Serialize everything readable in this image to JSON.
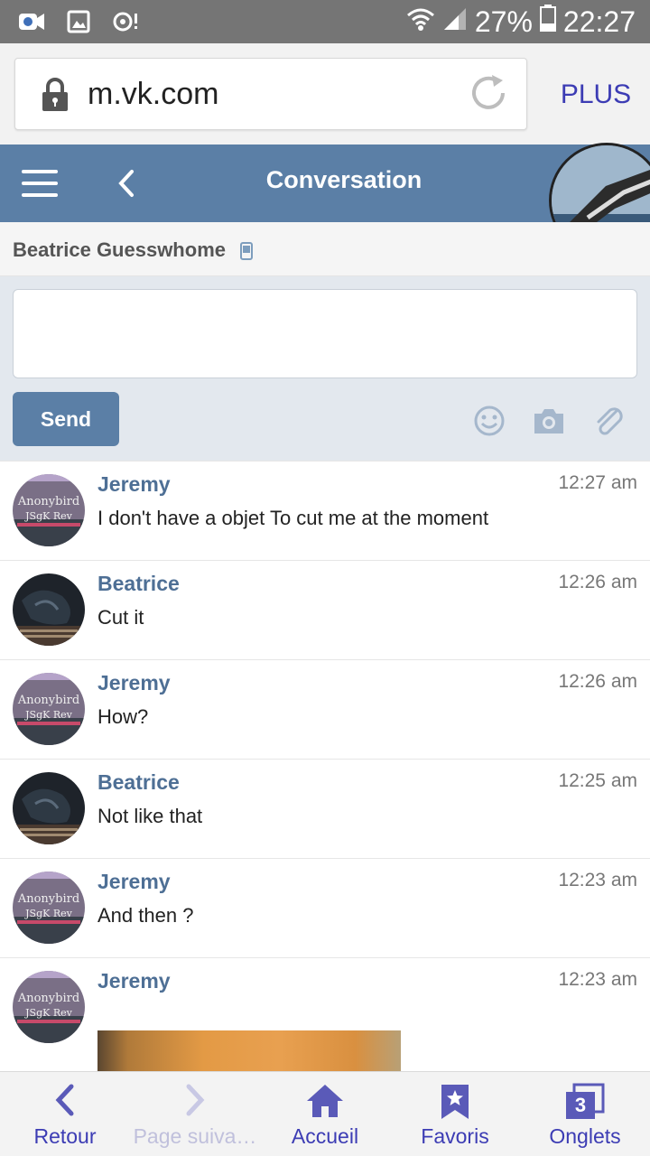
{
  "statusbar": {
    "battery": "27%",
    "time": "22:27"
  },
  "browser": {
    "url": "m.vk.com",
    "menu_label": "PLUS"
  },
  "header": {
    "title": "Conversation"
  },
  "peer": {
    "name": "Beatrice Guesswhome"
  },
  "compose": {
    "placeholder": "",
    "send_label": "Send"
  },
  "messages": [
    {
      "author": "Jeremy",
      "time": "12:27 am",
      "text": "I don't have a objet To cut me at the moment"
    },
    {
      "author": "Beatrice",
      "time": "12:26 am",
      "text": "Cut it"
    },
    {
      "author": "Jeremy",
      "time": "12:26 am",
      "text": "How?"
    },
    {
      "author": "Beatrice",
      "time": "12:25 am",
      "text": "Not like that"
    },
    {
      "author": "Jeremy",
      "time": "12:23 am",
      "text": "And then ?"
    },
    {
      "author": "Jeremy",
      "time": "12:23 am",
      "text": ""
    }
  ],
  "avatars": {
    "jeremy_line1": "Anonybird",
    "jeremy_line2": "JSgK Rev"
  },
  "bottomnav": {
    "back": "Retour",
    "forward": "Page suiva…",
    "home": "Accueil",
    "favorites": "Favoris",
    "tabs": "Onglets",
    "tabs_count": "3"
  },
  "colors": {
    "vk_header": "#5b7fa6",
    "accent": "#3c3cb4",
    "statusbar": "#757575"
  }
}
